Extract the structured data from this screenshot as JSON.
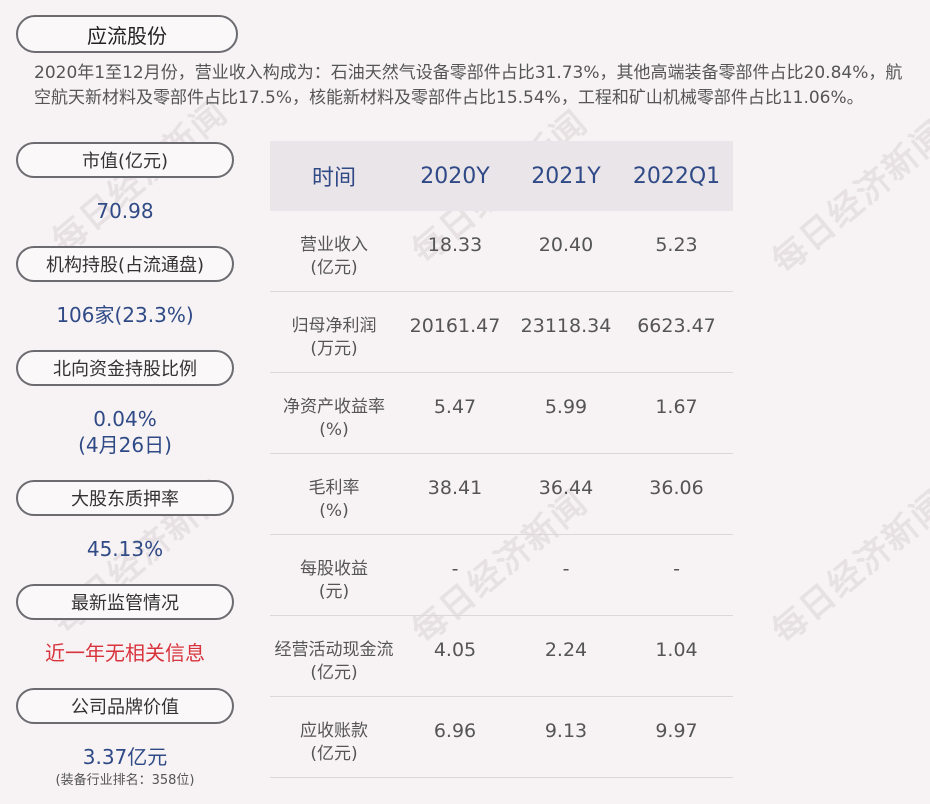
{
  "company": "应流股份",
  "summary": "2020年1至12月份，营业收入构成为：石油天然气设备零部件占比31.73%，其他高端装备零部件占比20.84%，航空航天新材料及零部件占比17.5%，核能新材料及零部件占比15.54%，工程和矿山机械零部件占比11.06%。",
  "left_panel": {
    "market_cap": {
      "label": "市值(亿元)",
      "value": "70.98"
    },
    "institutions": {
      "label": "机构持股(占流通盘)",
      "value": "106家(23.3%)"
    },
    "northbound": {
      "label": "北向资金持股比例",
      "value": "0.04%",
      "date": "(4月26日)"
    },
    "pledge": {
      "label": "大股东质押率",
      "value": "45.13%"
    },
    "regulation": {
      "label": "最新监管情况",
      "value": "近一年无相关信息"
    },
    "brand": {
      "label": "公司品牌价值",
      "value": "3.37亿元",
      "note": "(装备行业排名：358位)"
    }
  },
  "table": {
    "headers": [
      "时间",
      "2020Y",
      "2021Y",
      "2022Q1"
    ],
    "rows": [
      {
        "name": "营业收入",
        "unit": "(亿元)",
        "values": [
          "18.33",
          "20.40",
          "5.23"
        ]
      },
      {
        "name": "归母净利润",
        "unit": "(万元)",
        "values": [
          "20161.47",
          "23118.34",
          "6623.47"
        ]
      },
      {
        "name": "净资产收益率",
        "unit": "(%)",
        "values": [
          "5.47",
          "5.99",
          "1.67"
        ]
      },
      {
        "name": "毛利率",
        "unit": "(%)",
        "values": [
          "38.41",
          "36.44",
          "36.06"
        ]
      },
      {
        "name": "每股收益",
        "unit": "(元)",
        "values": [
          "-",
          "-",
          "-"
        ]
      },
      {
        "name": "经营活动现金流",
        "unit": "(亿元)",
        "values": [
          "4.05",
          "2.24",
          "1.04"
        ]
      },
      {
        "name": "应收账款",
        "unit": "(亿元)",
        "values": [
          "6.96",
          "9.13",
          "9.97"
        ]
      }
    ]
  },
  "watermark": "每日经济新闻"
}
